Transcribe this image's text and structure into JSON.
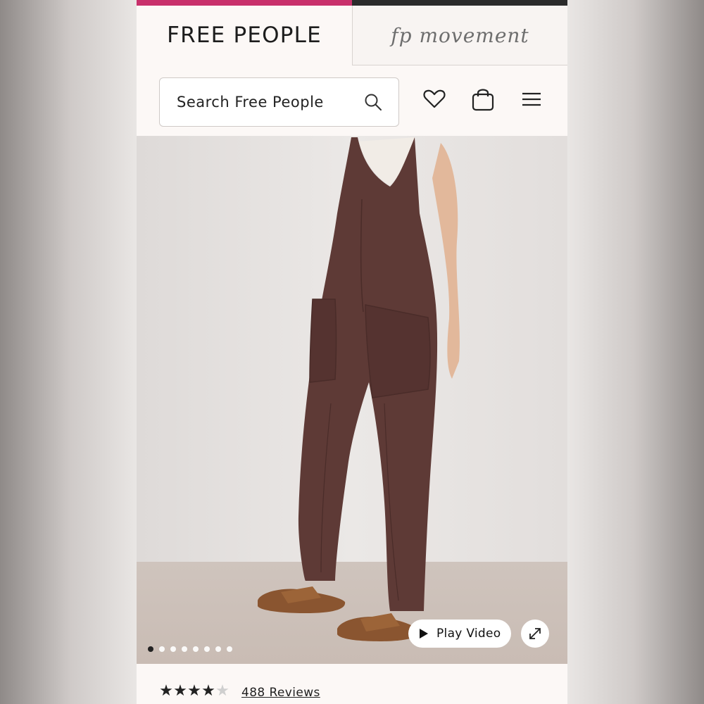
{
  "colors": {
    "accent_bar": "#c8306b",
    "garment": "#5e3a36",
    "background_wall": "#e6e3e1"
  },
  "header": {
    "brand": "FREE PEOPLE",
    "secondary_brand": "fp movement",
    "search_label": "Search Free People",
    "icons": [
      "search-icon",
      "heart-icon",
      "bag-icon",
      "menu-icon"
    ]
  },
  "gallery": {
    "dot_count": 8,
    "active_index": 0,
    "play_label": "Play Video",
    "expand_icon": "expand-icon"
  },
  "product": {
    "rating": 4,
    "rating_max": 5,
    "reviews_label": "488 Reviews"
  }
}
